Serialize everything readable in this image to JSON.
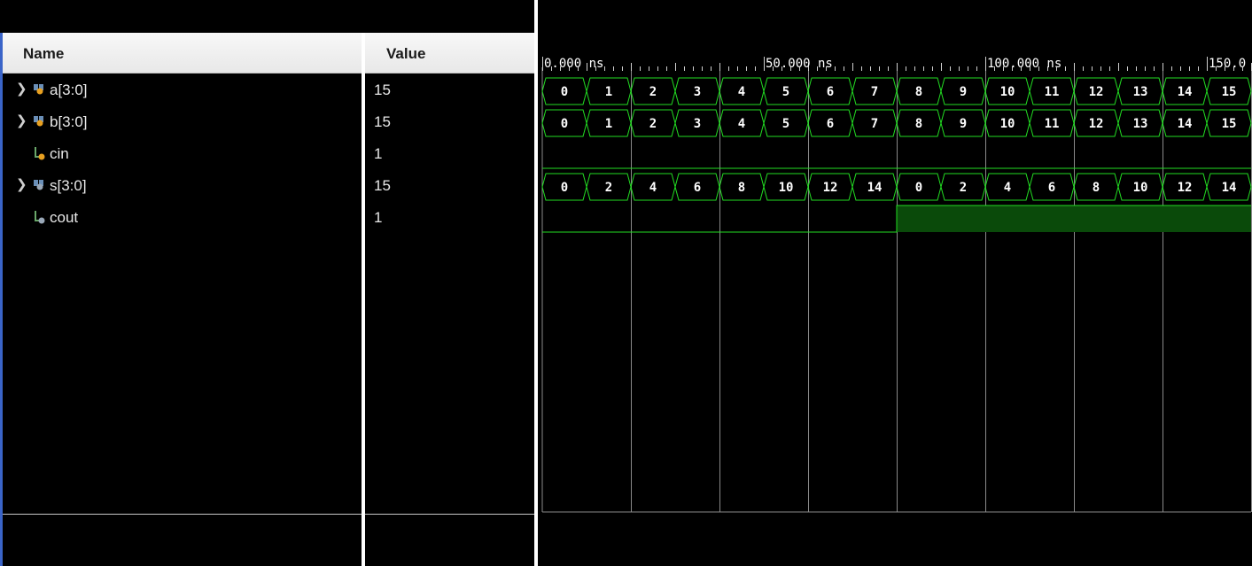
{
  "columns": {
    "name": "Name",
    "value": "Value"
  },
  "signals": [
    {
      "name": "a[3:0]",
      "value": "15",
      "type": "bus",
      "expandable": true
    },
    {
      "name": "b[3:0]",
      "value": "15",
      "type": "bus",
      "expandable": true
    },
    {
      "name": "cin",
      "value": "1",
      "type": "bit",
      "expandable": false
    },
    {
      "name": "s[3:0]",
      "value": "15",
      "type": "bus",
      "expandable": true
    },
    {
      "name": "cout",
      "value": "1",
      "type": "bit",
      "expandable": false
    }
  ],
  "timeline": {
    "unit": "ns",
    "labels": [
      "0.000 ns",
      "50.000 ns",
      "100.000 ns",
      "150.0"
    ],
    "label_times": [
      0,
      50,
      100,
      150
    ],
    "start": 0,
    "end": 160,
    "segment_ns": 10
  },
  "waveforms": {
    "a": [
      "0",
      "1",
      "2",
      "3",
      "4",
      "5",
      "6",
      "7",
      "8",
      "9",
      "10",
      "11",
      "12",
      "13",
      "14",
      "15"
    ],
    "b": [
      "0",
      "1",
      "2",
      "3",
      "4",
      "5",
      "6",
      "7",
      "8",
      "9",
      "10",
      "11",
      "12",
      "13",
      "14",
      "15"
    ],
    "cin": [
      0,
      0,
      0,
      0,
      0,
      0,
      0,
      0,
      0,
      0,
      0,
      0,
      0,
      0,
      0,
      0
    ],
    "s": [
      "0",
      "2",
      "4",
      "6",
      "8",
      "10",
      "12",
      "14",
      "0",
      "2",
      "4",
      "6",
      "8",
      "10",
      "12",
      "14"
    ],
    "cout": [
      0,
      0,
      0,
      0,
      0,
      0,
      0,
      0,
      1,
      1,
      1,
      1,
      1,
      1,
      1,
      1
    ]
  },
  "colors": {
    "wave": "#22dd22",
    "high_fill": "#0a4a0a",
    "grid": "#8a8a8a",
    "ruler_text": "#ffffff",
    "value_text": "#ffffff"
  },
  "icons": {
    "bus": "bus-signal-icon",
    "bit": "bit-signal-icon",
    "expand": "chevron-right-icon"
  }
}
